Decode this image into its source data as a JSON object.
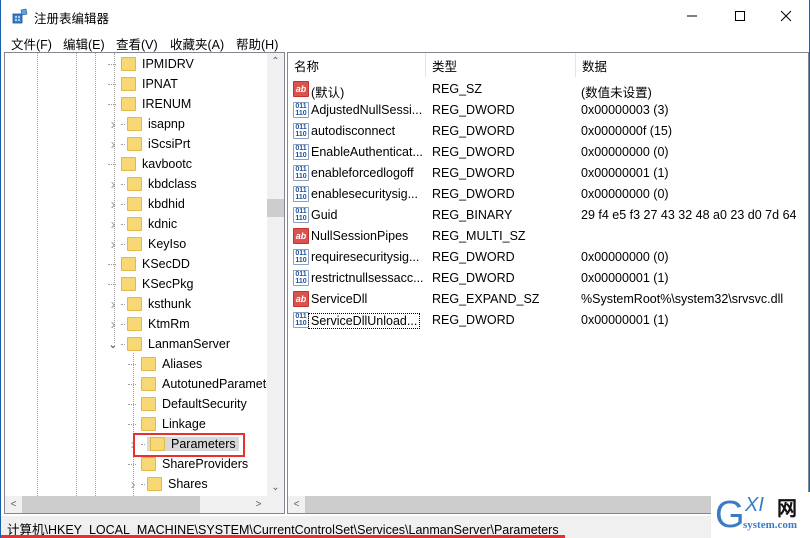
{
  "window": {
    "title": "注册表编辑器",
    "controls": {
      "minimize": "minimize",
      "maximize": "maximize",
      "close": "close"
    }
  },
  "menubar": {
    "items": [
      {
        "label": "文件(F)"
      },
      {
        "label": "编辑(E)"
      },
      {
        "label": "查看(V)"
      },
      {
        "label": "收藏夹(A)"
      },
      {
        "label": "帮助(H)"
      }
    ]
  },
  "tree": {
    "items": [
      {
        "label": "IPMIDRV",
        "expander": "none",
        "level": 1
      },
      {
        "label": "IPNAT",
        "expander": "none",
        "level": 1
      },
      {
        "label": "IRENUM",
        "expander": "none",
        "level": 1
      },
      {
        "label": "isapnp",
        "expander": "collapsed",
        "level": 1
      },
      {
        "label": "iScsiPrt",
        "expander": "collapsed",
        "level": 1
      },
      {
        "label": "kavbootc",
        "expander": "none",
        "level": 1
      },
      {
        "label": "kbdclass",
        "expander": "collapsed",
        "level": 1
      },
      {
        "label": "kbdhid",
        "expander": "collapsed",
        "level": 1
      },
      {
        "label": "kdnic",
        "expander": "collapsed",
        "level": 1
      },
      {
        "label": "KeyIso",
        "expander": "collapsed",
        "level": 1
      },
      {
        "label": "KSecDD",
        "expander": "none",
        "level": 1
      },
      {
        "label": "KSecPkg",
        "expander": "none",
        "level": 1
      },
      {
        "label": "ksthunk",
        "expander": "collapsed",
        "level": 1
      },
      {
        "label": "KtmRm",
        "expander": "collapsed",
        "level": 1
      },
      {
        "label": "LanmanServer",
        "expander": "expanded",
        "level": 1
      },
      {
        "label": "Aliases",
        "expander": "none",
        "level": 2
      },
      {
        "label": "AutotunedParameters",
        "expander": "none",
        "level": 2
      },
      {
        "label": "DefaultSecurity",
        "expander": "none",
        "level": 2
      },
      {
        "label": "Linkage",
        "expander": "none",
        "level": 2
      },
      {
        "label": "Parameters",
        "expander": "collapsed",
        "level": 2,
        "selected": true
      },
      {
        "label": "ShareProviders",
        "expander": "none",
        "level": 2
      },
      {
        "label": "Shares",
        "expander": "collapsed",
        "level": 2
      }
    ]
  },
  "list": {
    "columns": [
      {
        "label": "名称"
      },
      {
        "label": "类型"
      },
      {
        "label": "数据"
      }
    ],
    "rows": [
      {
        "icon": "string-value-icon",
        "name": "(默认)",
        "type": "REG_SZ",
        "data": "(数值未设置)"
      },
      {
        "icon": "binary-value-icon",
        "name": "AdjustedNullSessi...",
        "type": "REG_DWORD",
        "data": "0x00000003 (3)"
      },
      {
        "icon": "binary-value-icon",
        "name": "autodisconnect",
        "type": "REG_DWORD",
        "data": "0x0000000f (15)"
      },
      {
        "icon": "binary-value-icon",
        "name": "EnableAuthenticat...",
        "type": "REG_DWORD",
        "data": "0x00000000 (0)"
      },
      {
        "icon": "binary-value-icon",
        "name": "enableforcedlogoff",
        "type": "REG_DWORD",
        "data": "0x00000001 (1)"
      },
      {
        "icon": "binary-value-icon",
        "name": "enablesecuritysig...",
        "type": "REG_DWORD",
        "data": "0x00000000 (0)"
      },
      {
        "icon": "binary-value-icon",
        "name": "Guid",
        "type": "REG_BINARY",
        "data": "29 f4 e5 f3 27 43 32 48 a0 23 d0 7d 64"
      },
      {
        "icon": "string-value-icon",
        "name": "NullSessionPipes",
        "type": "REG_MULTI_SZ",
        "data": ""
      },
      {
        "icon": "binary-value-icon",
        "name": "requiresecuritysig...",
        "type": "REG_DWORD",
        "data": "0x00000000 (0)"
      },
      {
        "icon": "binary-value-icon",
        "name": "restrictnullsessacc...",
        "type": "REG_DWORD",
        "data": "0x00000001 (1)"
      },
      {
        "icon": "string-value-icon",
        "name": "ServiceDll",
        "type": "REG_EXPAND_SZ",
        "data": "%SystemRoot%\\system32\\srvsvc.dll"
      },
      {
        "icon": "binary-value-icon",
        "name": "ServiceDllUnload...",
        "type": "REG_DWORD",
        "data": "0x00000001 (1)",
        "focused": true
      }
    ]
  },
  "statusbar": {
    "path": "计算机\\HKEY_LOCAL_MACHINE\\SYSTEM\\CurrentControlSet\\Services\\LanmanServer\\Parameters"
  },
  "icons": {
    "ab": "ab",
    "bin_top": "011",
    "bin_bottom": "110"
  },
  "watermark": {
    "brand": "GXI",
    "brand_cn": "网",
    "domain": "system.com"
  },
  "colors": {
    "accent_border": "#1b5fa8",
    "highlight_red": "#e8312f",
    "folder": "#f8d775",
    "selection": "#d9d9d9"
  }
}
